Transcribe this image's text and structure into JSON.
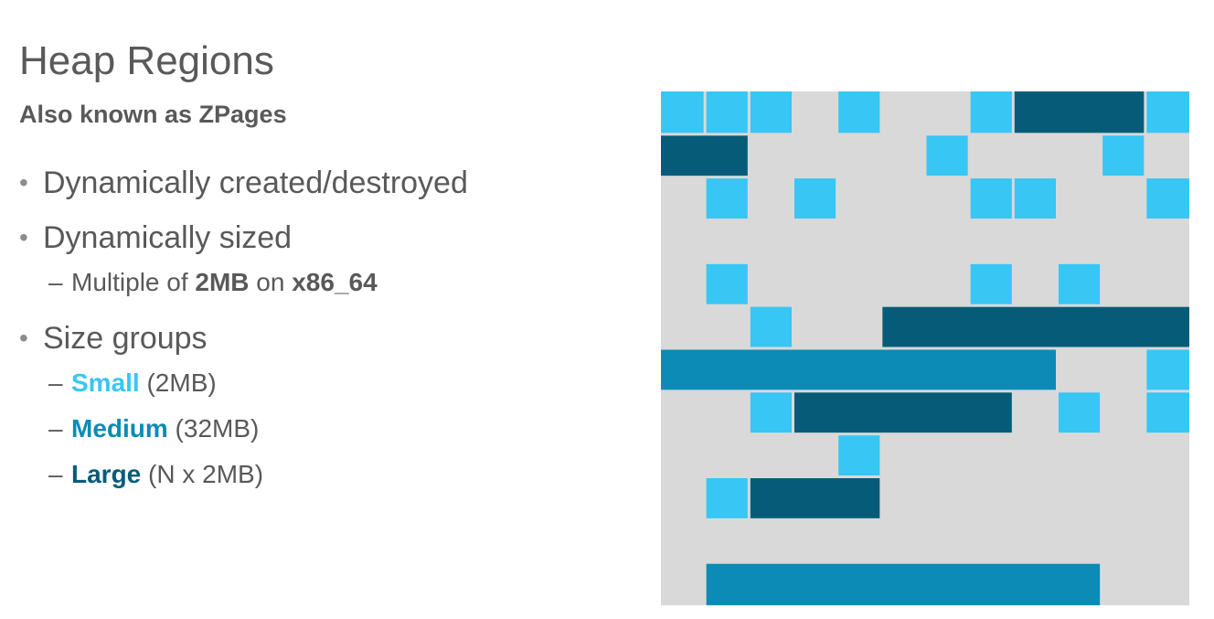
{
  "slide": {
    "title": "Heap Regions",
    "subtitle": "Also known as ZPages"
  },
  "bullets": [
    {
      "text": "Dynamically created/destroyed"
    },
    {
      "text": "Dynamically sized",
      "sub": {
        "prefix": "Multiple of ",
        "bold1": "2MB",
        "middle": " on ",
        "bold2": "x86_64"
      }
    },
    {
      "text": "Size groups",
      "groups": [
        {
          "name": "Small",
          "detail": " (2MB)",
          "color": "#38c6f4"
        },
        {
          "name": "Medium",
          "detail": " (32MB)",
          "color": "#0b8bb5"
        },
        {
          "name": "Large",
          "detail": " (N x 2MB)",
          "color": "#065c78"
        }
      ]
    }
  ],
  "heap_diagram": {
    "grid_columns": 12,
    "grid_rows": 12,
    "background_color": "#d9d9d9",
    "colors": {
      "small": "#38c6f4",
      "medium": "#0b8bb5",
      "large": "#065c78"
    },
    "regions": [
      {
        "type": "small",
        "row": 0,
        "col": 0,
        "span": 1
      },
      {
        "type": "small",
        "row": 0,
        "col": 1,
        "span": 1
      },
      {
        "type": "small",
        "row": 0,
        "col": 2,
        "span": 1
      },
      {
        "type": "small",
        "row": 0,
        "col": 4,
        "span": 1
      },
      {
        "type": "small",
        "row": 0,
        "col": 7,
        "span": 1
      },
      {
        "type": "large",
        "row": 0,
        "col": 8,
        "span": 3
      },
      {
        "type": "small",
        "row": 0,
        "col": 11,
        "span": 1
      },
      {
        "type": "large",
        "row": 1,
        "col": 0,
        "span": 2
      },
      {
        "type": "small",
        "row": 1,
        "col": 6,
        "span": 1
      },
      {
        "type": "small",
        "row": 1,
        "col": 10,
        "span": 1
      },
      {
        "type": "small",
        "row": 2,
        "col": 1,
        "span": 1
      },
      {
        "type": "small",
        "row": 2,
        "col": 3,
        "span": 1
      },
      {
        "type": "small",
        "row": 2,
        "col": 7,
        "span": 1
      },
      {
        "type": "small",
        "row": 2,
        "col": 8,
        "span": 1
      },
      {
        "type": "small",
        "row": 2,
        "col": 11,
        "span": 1
      },
      {
        "type": "small",
        "row": 4,
        "col": 1,
        "span": 1
      },
      {
        "type": "small",
        "row": 4,
        "col": 7,
        "span": 1
      },
      {
        "type": "small",
        "row": 4,
        "col": 9,
        "span": 1
      },
      {
        "type": "small",
        "row": 5,
        "col": 2,
        "span": 1
      },
      {
        "type": "large",
        "row": 5,
        "col": 5,
        "span": 7
      },
      {
        "type": "medium",
        "row": 6,
        "col": 0,
        "span": 9
      },
      {
        "type": "small",
        "row": 6,
        "col": 11,
        "span": 1
      },
      {
        "type": "small",
        "row": 7,
        "col": 2,
        "span": 1
      },
      {
        "type": "large",
        "row": 7,
        "col": 3,
        "span": 5
      },
      {
        "type": "small",
        "row": 7,
        "col": 9,
        "span": 1
      },
      {
        "type": "small",
        "row": 7,
        "col": 11,
        "span": 1
      },
      {
        "type": "small",
        "row": 8,
        "col": 4,
        "span": 1
      },
      {
        "type": "small",
        "row": 9,
        "col": 1,
        "span": 1
      },
      {
        "type": "large",
        "row": 9,
        "col": 2,
        "span": 3
      },
      {
        "type": "medium",
        "row": 11,
        "col": 1,
        "span": 9
      }
    ]
  }
}
